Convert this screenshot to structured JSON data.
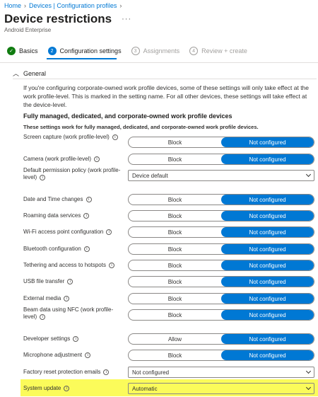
{
  "breadcrumb": [
    "Home",
    "Devices | Configuration profiles"
  ],
  "header": {
    "title": "Device restrictions",
    "more": "···",
    "subtitle": "Android Enterprise"
  },
  "steps": [
    {
      "num": "✓",
      "label": "Basics",
      "state": "done"
    },
    {
      "num": "2",
      "label": "Configuration settings",
      "state": "active"
    },
    {
      "num": "3",
      "label": "Assignments",
      "state": "inactive"
    },
    {
      "num": "4",
      "label": "Review + create",
      "state": "inactive"
    }
  ],
  "section": {
    "title": "General"
  },
  "info_text": "If you're configuring corporate-owned work profile devices, some of these settings will only take effect at the work profile-level. This is marked in the setting name. For all other devices, these settings will take effect at the device-level.",
  "group": {
    "title": "Fully managed, dedicated, and corporate-owned work profile devices",
    "description": "These settings work for fully managed, dedicated, and corporate-owned work profile devices."
  },
  "settings": [
    {
      "label": "Screen capture (work profile-level)",
      "type": "toggle",
      "options": [
        "Block",
        "Not configured"
      ],
      "selected": 1
    },
    {
      "label": "Camera (work profile-level)",
      "type": "toggle",
      "options": [
        "Block",
        "Not configured"
      ],
      "selected": 1
    },
    {
      "label": "Default permission policy (work profile-level)",
      "type": "dropdown",
      "value": "Device default"
    },
    {
      "label": "Date and Time changes",
      "type": "toggle",
      "options": [
        "Block",
        "Not configured"
      ],
      "selected": 1
    },
    {
      "label": "Roaming data services",
      "type": "toggle",
      "options": [
        "Block",
        "Not configured"
      ],
      "selected": 1
    },
    {
      "label": "Wi-Fi access point configuration",
      "type": "toggle",
      "options": [
        "Block",
        "Not configured"
      ],
      "selected": 1
    },
    {
      "label": "Bluetooth configuration",
      "type": "toggle",
      "options": [
        "Block",
        "Not configured"
      ],
      "selected": 1
    },
    {
      "label": "Tethering and access to hotspots",
      "type": "toggle",
      "options": [
        "Block",
        "Not configured"
      ],
      "selected": 1
    },
    {
      "label": "USB file transfer",
      "type": "toggle",
      "options": [
        "Block",
        "Not configured"
      ],
      "selected": 1
    },
    {
      "label": "External media",
      "type": "toggle",
      "options": [
        "Block",
        "Not configured"
      ],
      "selected": 1
    },
    {
      "label": "Beam data using NFC (work profile-level)",
      "type": "toggle",
      "options": [
        "Block",
        "Not configured"
      ],
      "selected": 1
    },
    {
      "label": "Developer settings",
      "type": "toggle",
      "options": [
        "Allow",
        "Not configured"
      ],
      "selected": 1
    },
    {
      "label": "Microphone adjustment",
      "type": "toggle",
      "options": [
        "Block",
        "Not configured"
      ],
      "selected": 1
    },
    {
      "label": "Factory reset protection emails",
      "type": "dropdown",
      "value": "Not configured"
    },
    {
      "label": "System update",
      "type": "dropdown",
      "value": "Automatic",
      "highlighted": true
    }
  ],
  "colors": {
    "accent": "#0078d4",
    "done": "#107c10",
    "highlight": "#fbfb5a"
  }
}
